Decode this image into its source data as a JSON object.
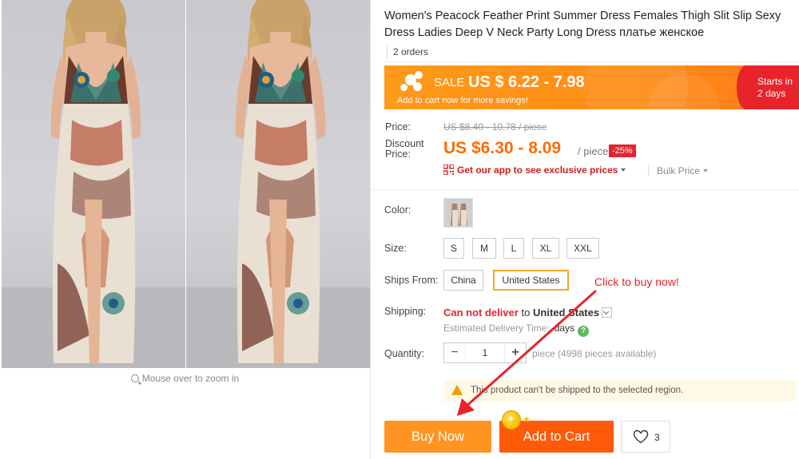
{
  "gallery": {
    "zoom_hint": "Mouse over to zoom in"
  },
  "product": {
    "title": "Women's Peacock Feather Print Summer Dress Females Thigh Slit Slip Sexy Dress Ladies Deep V Neck Party Long Dress платье женское",
    "orders": "2 orders"
  },
  "sale": {
    "label": "SALE",
    "price": "US $ 6.22 - 7.98",
    "subtitle": "Add to cart now for more savings!",
    "starts_line1": "Starts in",
    "starts_line2": "2 days"
  },
  "pricing": {
    "price_label": "Price:",
    "old_price": "US $8.40 - 10.78 / piece",
    "discount_label_line1": "Discount",
    "discount_label_line2": "Price:",
    "discount_price": "US $6.30 - 8.09",
    "per_piece": "/ piece",
    "discount_badge": "-25%",
    "app_promo": "Get our app to see exclusive prices",
    "bulk_price": "Bulk Price"
  },
  "options": {
    "color_label": "Color:",
    "size_label": "Size:",
    "sizes": [
      "S",
      "M",
      "L",
      "XL",
      "XXL"
    ],
    "ships_from_label": "Ships From:",
    "ships_from": [
      "China",
      "United States"
    ],
    "ships_from_selected": "United States"
  },
  "annotation": {
    "click_note": "Click to buy now!"
  },
  "shipping": {
    "label": "Shipping:",
    "cannot_deliver": "Can not deliver",
    "to": "to",
    "destination": "United States",
    "est_label": "Estimated Delivery Time:",
    "days": "days"
  },
  "quantity": {
    "label": "Quantity:",
    "value": "1",
    "note": "piece (4998 pieces available)"
  },
  "warning": {
    "text": "This product can't be shipped to the selected region."
  },
  "actions": {
    "buy_now": "Buy Now",
    "add_to_cart": "Add to Cart",
    "wishlist_count": "3"
  },
  "colors": {
    "accent_orange": "#ff6a00",
    "buy_now": "#ff9422",
    "add_to_cart": "#ff5a0a",
    "sale_red": "#e8232b",
    "selected_border": "#f5a623"
  }
}
